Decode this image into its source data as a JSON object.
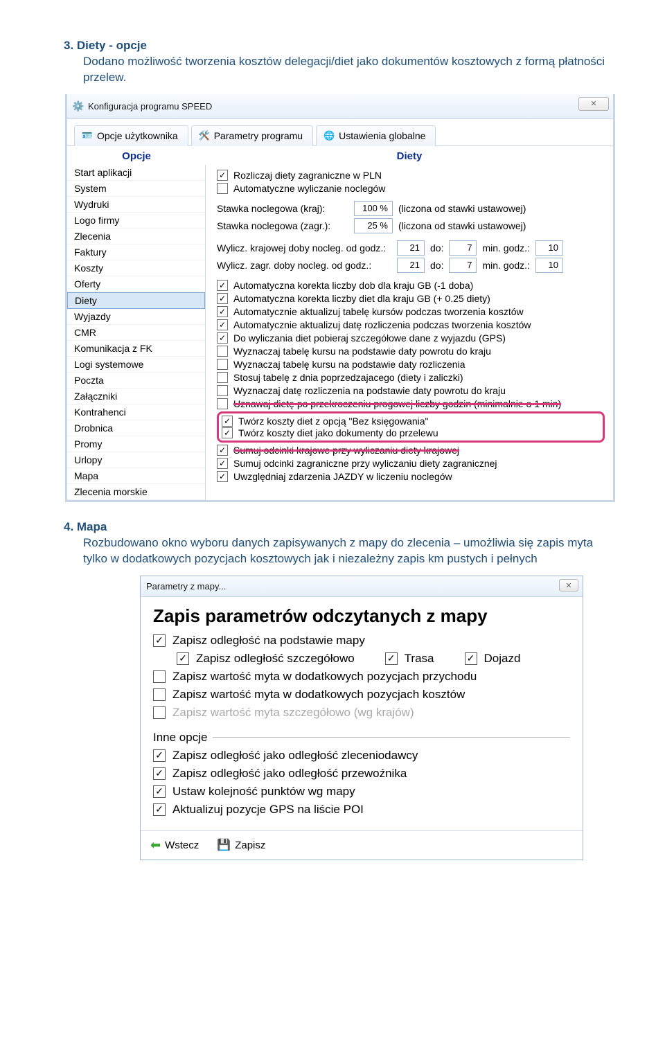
{
  "section3": {
    "heading": "3.  Diety - opcje",
    "body": "Dodano możliwość tworzenia kosztów delegacji/diet jako dokumentów kosztowych z formą płatności przelew."
  },
  "win1": {
    "title": "Konfiguracja programu SPEED",
    "close": "✕",
    "tabs": {
      "t1": "Opcje użytkownika",
      "t2": "Parametry programu",
      "t3": "Ustawienia globalne"
    },
    "colhead": {
      "opcje": "Opcje",
      "diety": "Diety"
    },
    "optlist": [
      "Start aplikacji",
      "System",
      "Wydruki",
      "Logo firmy",
      "Zlecenia",
      "Faktury",
      "Koszty",
      "Oferty",
      "Diety",
      "Wyjazdy",
      "CMR",
      "Komunikacja z FK",
      "Logi systemowe",
      "Poczta",
      "Załączniki",
      "Kontrahenci",
      "Drobnica",
      "Promy",
      "Urlopy",
      "Mapa",
      "Zlecenia morskie"
    ],
    "optsel": "Diety",
    "diety": {
      "rozliczaj_pln": "Rozliczaj diety zagraniczne w PLN",
      "auto_nocleg": "Automatyczne wyliczanie noclegów",
      "stawka_kraj_lbl": "Stawka noclegowa (kraj):",
      "stawka_kraj_val": "100 %",
      "stawka_zagr_lbl": "Stawka noclegowa (zagr.):",
      "stawka_zagr_val": "25 %",
      "liczona": "(liczona od stawki ustawowej)",
      "wyl_kraj_lbl": "Wylicz. krajowej doby nocleg. od godz.:",
      "wyl_zagr_lbl": "Wylicz. zagr. doby nocleg. od godz.:",
      "od1": "21",
      "do_lbl": "do:",
      "do1": "7",
      "min_lbl": "min. godz.:",
      "min1": "10",
      "od2": "21",
      "do2": "7",
      "min2": "10",
      "c1": "Automatyczna korekta liczby dob dla kraju GB (-1 doba)",
      "c2": "Automatyczna korekta liczby diet dla kraju GB (+ 0.25 diety)",
      "c3": "Automatycznie aktualizuj tabelę kursów podczas tworzenia kosztów",
      "c4": "Automatycznie aktualizuj datę rozliczenia podczas tworzenia kosztów",
      "c5": "Do wyliczania diet pobieraj szczegółowe dane z wyjazdu (GPS)",
      "c6": "Wyznaczaj tabelę kursu na podstawie daty powrotu do kraju",
      "c7": "Wyznaczaj tabelę kursu na podstawie daty rozliczenia",
      "c8": "Stosuj tabelę z dnia poprzedzajacego (diety i zaliczki)",
      "c9": "Wyznaczaj datę rozliczenia na podstawie daty powrotu do kraju",
      "c10": "Uznawaj dietę po przekroczeniu progowej liczby godzin (minimalnie o 1 min)",
      "h1": "Twórz koszty diet z opcją \"Bez księgowania\"",
      "h2": "Twórz koszty diet jako dokumenty do przelewu",
      "c11": "Sumuj odcinki krajowe przy wyliczaniu diety krajowej",
      "c12": "Sumuj odcinki zagraniczne przy wyliczaniu diety zagranicznej",
      "c13": "Uwzględniaj zdarzenia JAZDY w liczeniu noclegów"
    }
  },
  "section4": {
    "heading": "4.  Mapa",
    "body": "Rozbudowano okno wyboru danych zapisywanych z mapy do zlecenia – umożliwia się zapis myta tylko w dodatkowych pozycjach kosztowych jak i niezależny zapis km pustych i pełnych"
  },
  "win2": {
    "title": "Parametry z mapy...",
    "close": "✕",
    "heading": "Zapis parametrów odczytanych z mapy",
    "r1": "Zapisz odległość na podstawie mapy",
    "r1a": "Zapisz odległość szczegółowo",
    "r1b": "Trasa",
    "r1c": "Dojazd",
    "r2": "Zapisz wartość myta w dodatkowych pozycjach przychodu",
    "r3": "Zapisz wartość myta w dodatkowych pozycjach kosztów",
    "r4": "Zapisz wartość myta szczegółowo (wg krajów)",
    "legend": "Inne opcje",
    "r5": "Zapisz odległość jako odległość zleceniodawcy",
    "r6": "Zapisz odległość jako odległość przewoźnika",
    "r7": "Ustaw kolejność punktów wg mapy",
    "r8": "Aktualizuj pozycje GPS na liście POI",
    "btn_back": "Wstecz",
    "btn_save": "Zapisz"
  }
}
